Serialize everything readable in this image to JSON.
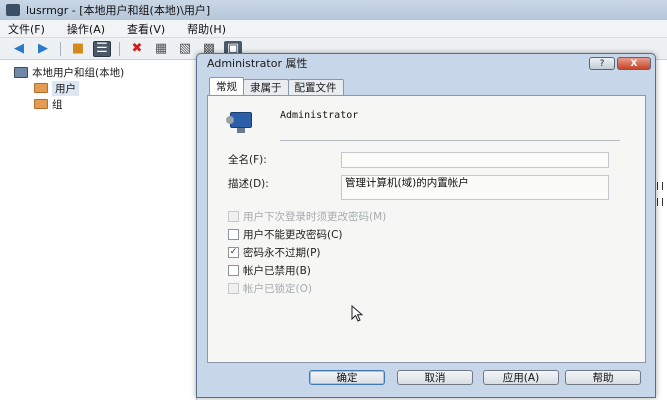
{
  "app": {
    "title": "lusrmgr - [本地用户和组(本地)\\用户]",
    "menu": [
      "文件(F)",
      "操作(A)",
      "查看(V)",
      "帮助(H)"
    ],
    "toolbar_icons": [
      "arrow-left-icon",
      "arrow-right-icon",
      "up-folder-icon",
      "list-view-icon",
      "delete-icon",
      "properties-icon",
      "export-icon",
      "refresh-icon",
      "help-icon"
    ]
  },
  "tree": {
    "root": "本地用户和组(本地)",
    "children": [
      "用户",
      "组"
    ]
  },
  "dialog": {
    "title": "Administrator 属性",
    "title_buttons": {
      "help": "?",
      "close": "X"
    },
    "tabs": [
      "常规",
      "隶属于",
      "配置文件"
    ],
    "active_tab": 0,
    "user_name": "Administrator",
    "fields": {
      "fullname_label": "全名(F):",
      "fullname_value": "",
      "desc_label": "描述(D):",
      "desc_value": "管理计算机(域)的内置帐户"
    },
    "checkboxes": [
      {
        "label": "用户下次登录时须更改密码(M)",
        "checked": false,
        "disabled": true
      },
      {
        "label": "用户不能更改密码(C)",
        "checked": false,
        "disabled": false
      },
      {
        "label": "密码永不过期(P)",
        "checked": true,
        "disabled": false
      },
      {
        "label": "帐户已禁用(B)",
        "checked": false,
        "disabled": false
      },
      {
        "label": "帐户已锁定(O)",
        "checked": false,
        "disabled": true
      }
    ],
    "buttons": {
      "ok": "确定",
      "cancel": "取消",
      "apply": "应用(A)",
      "help": "帮助"
    }
  }
}
